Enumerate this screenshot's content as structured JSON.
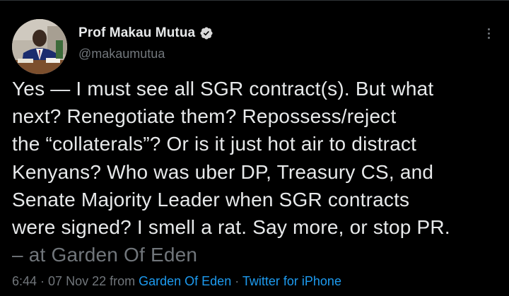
{
  "author": {
    "display_name": "Prof Makau Mutua",
    "handle": "@makaumutua",
    "verified_icon": "verified-badge-icon",
    "avatar_icon": "profile-photo"
  },
  "menu": {
    "icon": "more-vertical-icon"
  },
  "tweet": {
    "lines": [
      "Yes — I must see all SGR contract(s). But what",
      "next?  Renegotiate them?  Repossess/reject",
      "the “collaterals”? Or is it just hot air to distract",
      "Kenyans?  Who was uber DP, Treasury CS, and",
      "Senate Majority Leader when SGR contracts",
      "were signed?  I smell a rat. Say more, or stop PR."
    ],
    "location_line": "– at Garden Of Eden"
  },
  "meta": {
    "time": "6:44",
    "sep1": " · ",
    "date": "07 Nov 22",
    "from_label": " from ",
    "location_link": "Garden Of Eden",
    "sep2": " · ",
    "client_link": "Twitter for iPhone"
  },
  "colors": {
    "background": "#000000",
    "text_primary": "#e7e9ea",
    "text_secondary": "#71767b",
    "link": "#1d9bf0",
    "verified_badge": "#d9d9d9"
  }
}
